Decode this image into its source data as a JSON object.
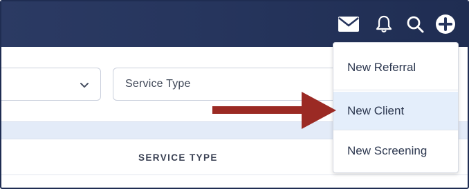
{
  "header": {
    "icons": [
      "mail-icon",
      "bell-icon",
      "search-icon",
      "plus-circle-icon"
    ]
  },
  "filters": {
    "service_type_placeholder": "Service Type"
  },
  "table": {
    "service_type_header": "SERVICE TYPE"
  },
  "add_menu": {
    "items": [
      "New Referral",
      "New Client",
      "New Screening"
    ],
    "highlighted": "New Client"
  },
  "colors": {
    "header_bg": "#26355d",
    "arrow": "#9b2a24",
    "highlight": "#e4eefb",
    "band": "#e3ebf8"
  }
}
